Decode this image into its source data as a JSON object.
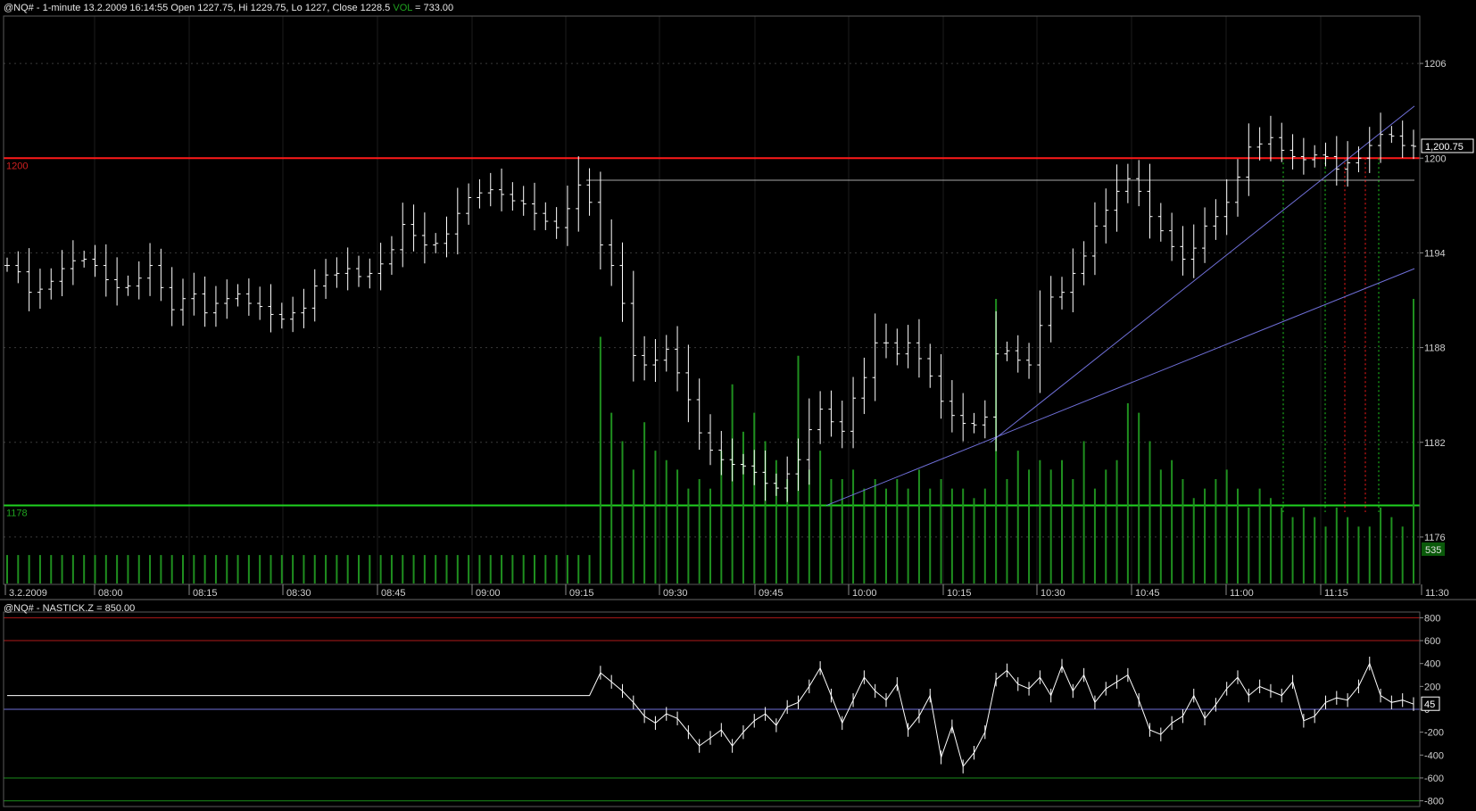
{
  "header": {
    "symbol": "@NQ#",
    "interval": "1-minute",
    "datetime": "13.2.2009 16:14:55",
    "open_label": "Open",
    "open": "1227.75",
    "hi_label": "Hi",
    "hi": "1229.75",
    "lo_label": "Lo",
    "lo": "1227",
    "close_label": "Close",
    "close": "1228.5",
    "vol_label": "VOL",
    "vol_value": "733.00"
  },
  "lower_header": {
    "symbol": "@NQ#",
    "indicator": "NASTICK.Z",
    "value": "850.00"
  },
  "colors": {
    "background": "#000000",
    "price_bars": "#ffffff",
    "volume": "#1f8f1f",
    "resistance": "#ff1a1a",
    "support": "#1fd21f",
    "trendline": "#6f6fd8",
    "horizontal": "#a8a8a8"
  },
  "chart_data": [
    {
      "type": "bar",
      "subtype": "ohlc",
      "x_ticks": [
        "3.2.2009",
        "08:00",
        "08:15",
        "08:30",
        "08:45",
        "09:00",
        "09:15",
        "09:30",
        "09:45",
        "10:00",
        "10:15",
        "10:30",
        "10:45",
        "11:00",
        "11:15",
        "11:30"
      ],
      "y_ticks": [
        1176,
        1182,
        1188,
        1194,
        1200,
        1206
      ],
      "ylim": [
        1173,
        1209
      ],
      "last_price_label": "1,200.75",
      "last_volume_label": "535",
      "horizontal_lines": [
        {
          "label": "1200",
          "value": 1200,
          "color": "red"
        },
        {
          "label": "1178",
          "value": 1178,
          "color": "green"
        },
        {
          "label": "",
          "value": 1198.6,
          "color": "gray"
        }
      ],
      "price_close": [
        1193.2,
        1192.8,
        1191.5,
        1191.7,
        1192.2,
        1193,
        1193.5,
        1193.6,
        1193.2,
        1192.3,
        1191.8,
        1191.9,
        1192.4,
        1193.2,
        1191.8,
        1190.4,
        1191.1,
        1191.4,
        1190.2,
        1190.8,
        1191.1,
        1191.4,
        1190.8,
        1190.6,
        1190.1,
        1189.8,
        1190.2,
        1190.5,
        1191.9,
        1192.6,
        1192.7,
        1193,
        1192.5,
        1192.7,
        1193.3,
        1194.2,
        1195.8,
        1195.1,
        1194.5,
        1194.6,
        1195.2,
        1196.5,
        1197.5,
        1197.8,
        1198,
        1197.7,
        1197.3,
        1197.1,
        1196.5,
        1196,
        1195.6,
        1196.8,
        1198.3,
        1197.2,
        1194.5,
        1193.2,
        1190.8,
        1187.5,
        1186.9,
        1187.2,
        1187.9,
        1186.4,
        1184.7,
        1182.6,
        1181.5,
        1180.9,
        1180.6,
        1180.5,
        1180.1,
        1179.4,
        1179.1,
        1180,
        1180.9,
        1182.8,
        1184.1,
        1183.3,
        1182.7,
        1184.8,
        1186.1,
        1188.3,
        1188.3,
        1187.6,
        1188.3,
        1187.3,
        1186.2,
        1184.6,
        1183.7,
        1183.2,
        1183.1,
        1183.6,
        1187.6,
        1187.8,
        1187.2,
        1186.9,
        1189.4,
        1191.2,
        1191.5,
        1192.7,
        1193.8,
        1195.7,
        1196.7,
        1197.9,
        1198.7,
        1197.9,
        1196.3,
        1195.4,
        1194.4,
        1193.6,
        1194.3,
        1195.7,
        1196.3,
        1197.2,
        1198.8,
        1200.7,
        1200.9,
        1201.3,
        1200.5,
        1200.1,
        1199.9,
        1200.2,
        1200.1,
        1199.3,
        1199.7,
        1200,
        1200.8,
        1201.5,
        1201.4,
        1200.8,
        1200.75
      ],
      "volume": [
        30,
        30,
        30,
        30,
        30,
        30,
        30,
        30,
        30,
        30,
        30,
        30,
        30,
        30,
        30,
        30,
        30,
        30,
        30,
        30,
        30,
        30,
        30,
        30,
        30,
        30,
        30,
        30,
        30,
        30,
        30,
        30,
        30,
        30,
        30,
        30,
        30,
        30,
        30,
        30,
        30,
        30,
        30,
        30,
        30,
        30,
        30,
        30,
        30,
        30,
        30,
        30,
        30,
        30,
        260,
        180,
        150,
        120,
        170,
        140,
        130,
        120,
        100,
        110,
        100,
        140,
        210,
        160,
        180,
        150,
        130,
        110,
        240,
        120,
        140,
        110,
        110,
        120,
        100,
        110,
        100,
        110,
        100,
        120,
        100,
        110,
        100,
        100,
        90,
        100,
        300,
        110,
        140,
        120,
        130,
        120,
        130,
        110,
        150,
        100,
        120,
        130,
        190,
        180,
        150,
        120,
        130,
        110,
        90,
        100,
        110,
        120,
        100,
        80,
        100,
        90,
        80,
        70,
        80,
        70,
        60,
        80,
        70,
        60,
        60,
        80,
        70,
        60,
        535
      ]
    },
    {
      "type": "line",
      "name": "NASTICK.Z",
      "y_ticks": [
        800,
        600,
        400,
        200,
        0,
        -200,
        -400,
        -600,
        -800
      ],
      "ylim": [
        -850,
        850
      ],
      "reference_lines": [
        {
          "value": 800,
          "color": "red"
        },
        {
          "value": 600,
          "color": "red"
        },
        {
          "value": 0,
          "color": "blue"
        },
        {
          "value": -600,
          "color": "green"
        },
        {
          "value": -800,
          "color": "green"
        }
      ],
      "last_value_label": "45",
      "values": [
        120,
        120,
        120,
        120,
        120,
        120,
        120,
        120,
        120,
        120,
        120,
        120,
        120,
        120,
        120,
        120,
        120,
        120,
        120,
        120,
        120,
        120,
        120,
        120,
        120,
        120,
        120,
        120,
        120,
        120,
        120,
        120,
        120,
        120,
        120,
        120,
        120,
        120,
        120,
        120,
        120,
        120,
        120,
        120,
        120,
        120,
        120,
        120,
        120,
        120,
        120,
        120,
        120,
        120,
        320,
        240,
        160,
        60,
        -60,
        -120,
        -40,
        -80,
        -200,
        -320,
        -250,
        -180,
        -320,
        -200,
        -100,
        -40,
        -140,
        20,
        60,
        200,
        360,
        120,
        -120,
        80,
        280,
        160,
        80,
        220,
        -180,
        -60,
        120,
        -420,
        -150,
        -500,
        -380,
        -200,
        260,
        340,
        220,
        180,
        280,
        120,
        380,
        160,
        300,
        60,
        180,
        240,
        300,
        80,
        -180,
        -220,
        -120,
        -60,
        120,
        -80,
        40,
        180,
        280,
        120,
        200,
        160,
        120,
        240,
        -100,
        -60,
        60,
        100,
        80,
        200,
        400,
        120,
        60,
        80,
        45
      ]
    }
  ]
}
